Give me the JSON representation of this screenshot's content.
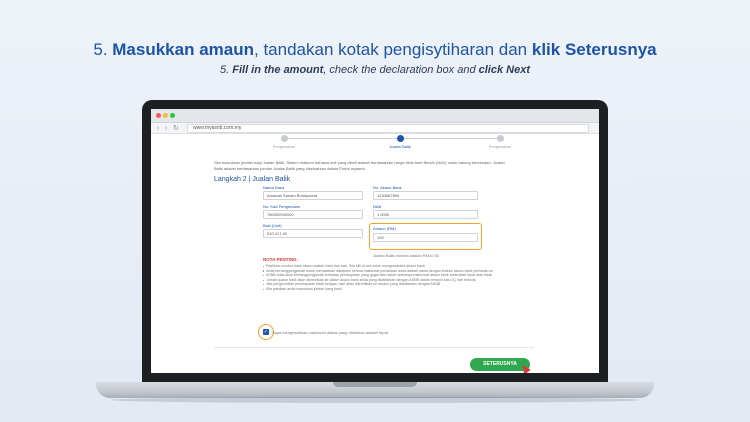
{
  "heading": {
    "ms_part1": "5. ",
    "ms_bold1": "Masukkan amaun",
    "ms_part2": ", tandakan kotak pengisytiharan dan ",
    "ms_bold2": "klik Seterusnya",
    "en_part1": "5. ",
    "en_bold1": "Fill in the amount",
    "en_part2": ", check the declaration box and ",
    "en_bold2": "click Next"
  },
  "browser": {
    "url": "www.myasnb.com.my",
    "nav_back": "‹",
    "nav_forward": "›",
    "nav_reload": "↻"
  },
  "steps": [
    {
      "label": "Pengesahan",
      "active": false
    },
    {
      "label": "Jualan Balik",
      "active": true
    },
    {
      "label": "Pengesahan",
      "active": false
    }
  ],
  "form": {
    "intro": "Sila masukkan jumlah bagi Jualan Balik. Sistem maklum bahawa unit yang dibeli adalah berdasarkan harga Nilai Aset Bersih (NAV) untuk tabung berkenaan. Jualan Balik adalah berdasarkan jumlah Jualan Balik yang dikeluarkan dalam Portal myasnb.",
    "section_title": "Langkah 2 | Jualan Balik",
    "fields": {
      "nama_dana": {
        "label": "Nama Dana",
        "value": "Amanah Saham Bumiputera"
      },
      "no_akaun": {
        "label": "No. Akaun Bank",
        "value": "1234567890"
      },
      "no_kad": {
        "label": "No. Kad Pengenalan",
        "value": "780000000000"
      },
      "nilai": {
        "label": "NAB",
        "value": "1.0000"
      },
      "baki": {
        "label": "Baki (Unit)",
        "value": "510,417.40"
      },
      "amaun": {
        "label": "Amaun (RM)",
        "value": "100"
      }
    },
    "amount_hint": "Jualan Balik minima adalah RM10.00"
  },
  "notes": {
    "title": "NOTA PENTING:",
    "items": [
      "Pastikan nombor bank akaun adalah betul dan sah. Sila klik di sini untuk mengemaskini akaun bank",
      "Anda bertanggungjawab untuk memastikan databank semua maklumat perbankan anda adalah sama dengan butiran akaun bank perbadan anda",
      "ASNB tidak akan bertanggungjawab terhadap pembayaran yang gagal atau salah sekiranya maklumat akaun bank anda tidak tepat atau tidak sah",
      "Jumlah jualan balik akan dikreditkan ke dalam akaun bank anda yang didaftarkan dengan ASNB dalam tempoh satu (1) hari bekerja",
      "Jika pengkreditan pembayaran tidak berjaya, baki akan dikreditkan ke amaun yang didaftarkan dengan ASNB",
      "Sila pastikan anda masukkan jumlah yang betul"
    ]
  },
  "declaration": {
    "text": "Saya mengesahkan maklumat diatas yang diberikan adalah tepat",
    "checked": true
  },
  "actions": {
    "next_label": "SETERUSNYA"
  },
  "colors": {
    "brand_blue": "#1d55a6",
    "highlight_orange": "#f0a22e",
    "button_green": "#2fa84f",
    "note_red": "#d63a3a"
  }
}
